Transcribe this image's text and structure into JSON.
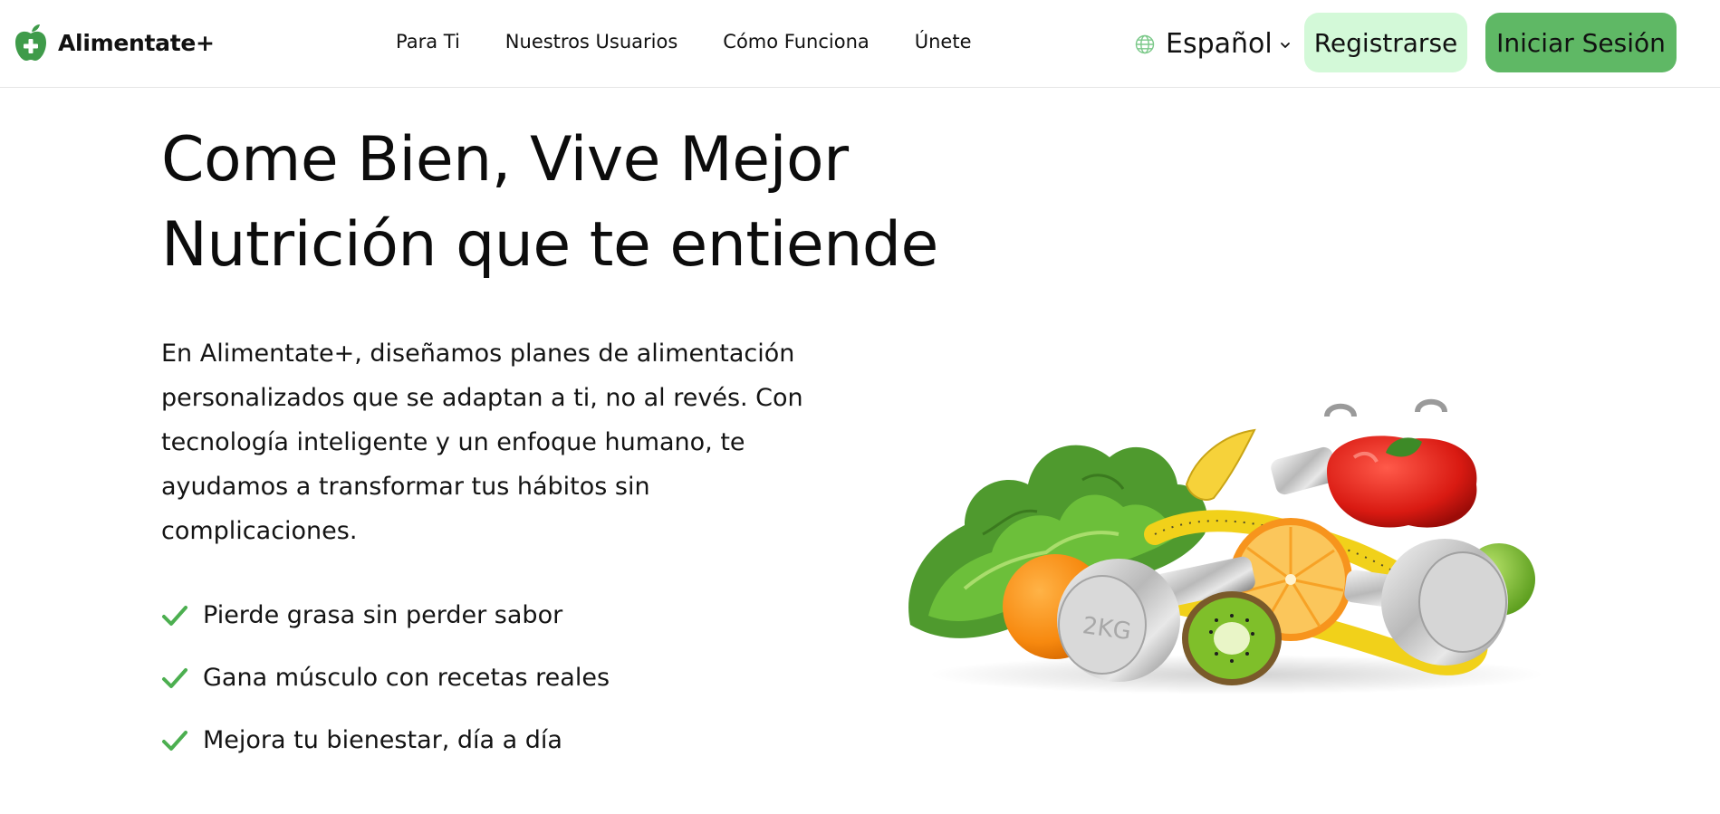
{
  "brand": {
    "name": "Alimentate+",
    "logo_icon": "apple-plus-icon",
    "color": "#3f9b4a"
  },
  "nav": {
    "items": [
      {
        "label": "Para Ti"
      },
      {
        "label": "Nuestros Usuarios"
      },
      {
        "label": "Cómo Funciona"
      },
      {
        "label": "Únete"
      }
    ]
  },
  "language": {
    "label": "Español",
    "icon": "globe-icon"
  },
  "auth": {
    "register_label": "Registrarse",
    "login_label": "Iniciar Sesión",
    "register_color": "#d3f9d8",
    "login_color": "#5fb865"
  },
  "hero": {
    "title_line1": "Come Bien, Vive Mejor",
    "title_line2": "Nutrición que te entiende",
    "description": "En Alimentate+, diseñamos planes de alimentación personalizados que se adaptan a ti, no al revés. Con tecnología inteligente y un enfoque humano, te ayudamos a transformar tus hábitos sin complicaciones.",
    "benefits": [
      {
        "text": "Pierde grasa sin perder sabor"
      },
      {
        "text": "Gana músculo con recetas reales"
      },
      {
        "text": "Mejora tu bienestar, día a día"
      }
    ],
    "check_color": "#4caf50",
    "image_label": "2KG"
  }
}
